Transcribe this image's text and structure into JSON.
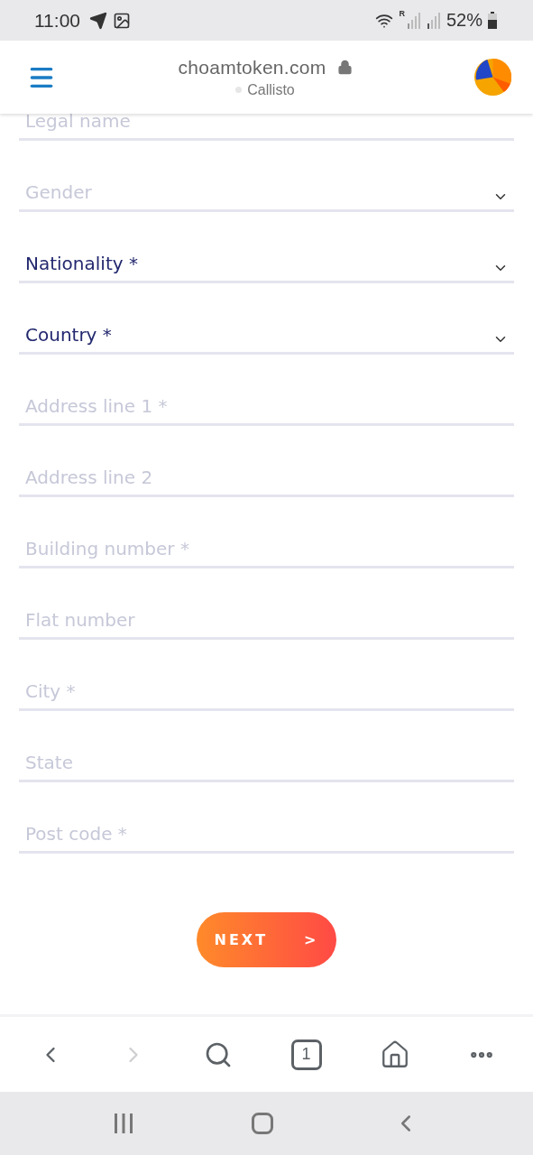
{
  "status_bar": {
    "time": "11:00",
    "battery": "52%",
    "roaming": "R"
  },
  "header": {
    "domain": "choamtoken.com",
    "network": "Callisto"
  },
  "fields": [
    {
      "kind": "text",
      "placeholder": "Legal name",
      "active": false
    },
    {
      "kind": "select",
      "placeholder": "Gender",
      "active": false
    },
    {
      "kind": "select",
      "placeholder": "Nationality *",
      "active": true
    },
    {
      "kind": "select",
      "placeholder": "Country *",
      "active": true
    },
    {
      "kind": "text",
      "placeholder": "Address line 1 *",
      "active": false
    },
    {
      "kind": "text",
      "placeholder": "Address line 2",
      "active": false
    },
    {
      "kind": "text",
      "placeholder": "Building number *",
      "active": false
    },
    {
      "kind": "text",
      "placeholder": "Flat number",
      "active": false
    },
    {
      "kind": "text",
      "placeholder": "City *",
      "active": false
    },
    {
      "kind": "text",
      "placeholder": "State",
      "active": false
    },
    {
      "kind": "text",
      "placeholder": "Post code *",
      "active": false
    }
  ],
  "next_button": {
    "label": "NEXT",
    "arrow": ">"
  },
  "browser_toolbar": {
    "back_disabled": false,
    "forward_disabled": true,
    "tab_count": "1"
  }
}
